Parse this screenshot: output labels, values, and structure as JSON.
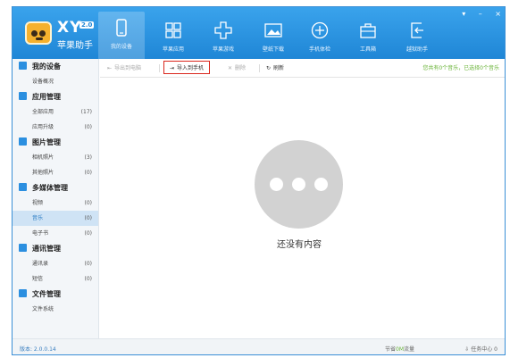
{
  "header": {
    "logo_text": "XY",
    "version_badge": "2.0",
    "subtitle": "苹果助手",
    "nav": [
      {
        "label": "我的设备",
        "icon": "phone-icon"
      },
      {
        "label": "苹果应用",
        "icon": "apps-grid-icon"
      },
      {
        "label": "苹果游戏",
        "icon": "gamepad-icon"
      },
      {
        "label": "壁纸下载",
        "icon": "wallpaper-icon"
      },
      {
        "label": "手机体检",
        "icon": "checkup-icon"
      },
      {
        "label": "工具箱",
        "icon": "toolbox-icon"
      },
      {
        "label": "越狱助手",
        "icon": "jailbreak-icon"
      }
    ],
    "window_controls": [
      "▾",
      "–",
      "×"
    ]
  },
  "sidebar": [
    {
      "title": "我的设备",
      "icon": "device-icon",
      "items": [
        {
          "label": "设备概况",
          "count": ""
        }
      ]
    },
    {
      "title": "应用管理",
      "icon": "app-manage-icon",
      "items": [
        {
          "label": "全部应用",
          "count": "(17)"
        },
        {
          "label": "应用升级",
          "count": "(0)"
        }
      ]
    },
    {
      "title": "图片管理",
      "icon": "image-manage-icon",
      "items": [
        {
          "label": "相机照片",
          "count": "(3)"
        },
        {
          "label": "其他照片",
          "count": "(0)"
        }
      ]
    },
    {
      "title": "多媒体管理",
      "icon": "media-manage-icon",
      "items": [
        {
          "label": "视频",
          "count": "(0)"
        },
        {
          "label": "音乐",
          "count": "(0)"
        },
        {
          "label": "电子书",
          "count": "(0)"
        }
      ]
    },
    {
      "title": "通讯管理",
      "icon": "comm-manage-icon",
      "items": [
        {
          "label": "通讯录",
          "count": "(0)"
        },
        {
          "label": "短信",
          "count": "(0)"
        }
      ]
    },
    {
      "title": "文件管理",
      "icon": "file-manage-icon",
      "items": [
        {
          "label": "文件系统",
          "count": ""
        }
      ]
    }
  ],
  "toolbar": {
    "export_to_pc": "导出到电脑",
    "import_to_phone": "导入到手机",
    "delete": "删除",
    "refresh": "刷新",
    "status": "您共有0个音乐，已选择0个音乐"
  },
  "empty_state": {
    "text": "还没有内容"
  },
  "footer": {
    "version": "版本: 2.0.0.14",
    "traffic_prefix": "节省",
    "traffic_value": "0M",
    "traffic_suffix": "流量",
    "task_center": "任务中心",
    "task_count": "0"
  }
}
